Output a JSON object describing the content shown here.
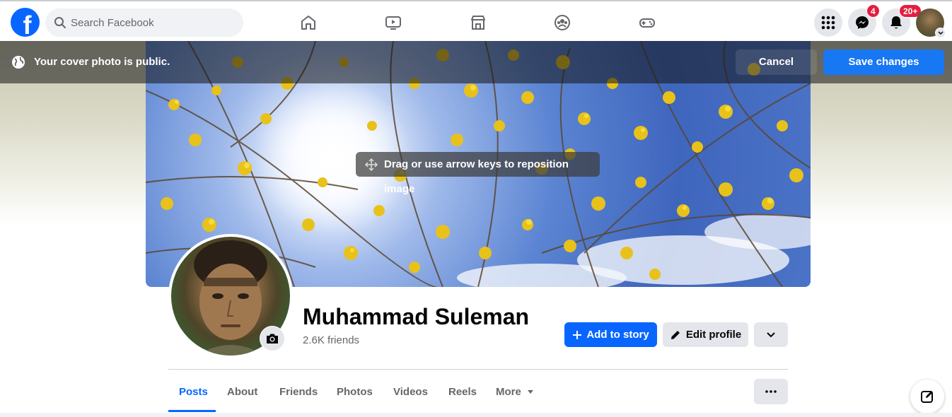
{
  "topnav": {
    "logo": "f",
    "search_placeholder": "Search Facebook",
    "messenger_badge": "4",
    "notifications_badge": "20+"
  },
  "banner": {
    "message": "Your cover photo is public.",
    "cancel_label": "Cancel",
    "save_label": "Save changes"
  },
  "cover": {
    "drag_hint": "Drag or use arrow keys to reposition image"
  },
  "profile": {
    "name": "Muhammad Suleman",
    "friends": "2.6K friends",
    "add_story_label": "Add to story",
    "edit_profile_label": "Edit profile"
  },
  "tabs": [
    {
      "label": "Posts",
      "active": true
    },
    {
      "label": "About"
    },
    {
      "label": "Friends"
    },
    {
      "label": "Photos"
    },
    {
      "label": "Videos"
    },
    {
      "label": "Reels"
    },
    {
      "label": "More"
    }
  ],
  "colors": {
    "brand": "#0866ff",
    "badge": "#e41e3f",
    "button_gray": "#e4e6eb"
  }
}
